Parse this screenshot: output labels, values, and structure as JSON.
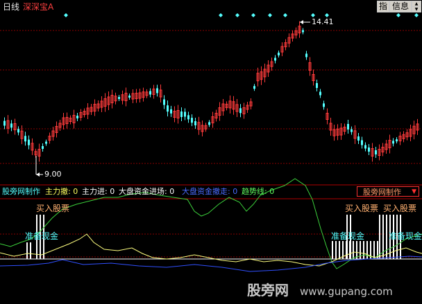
{
  "topbar": {
    "period": "日线",
    "stock_name": "深深宝A",
    "btn_indicator": "指",
    "btn_info": "信息",
    "btn_down_arrow": "▼",
    "btn_up_arrow": "▲"
  },
  "main_chart": {
    "high_label": "14.41",
    "low_label": "9.00"
  },
  "indicator_bar": {
    "name": "股旁网制作",
    "items": [
      {
        "label": "主力撤: 0",
        "color": "#ffff60"
      },
      {
        "label": "主力进: 0",
        "color": "#ffffff"
      },
      {
        "label": "大盘资金进场: 0",
        "color": "#ffffff"
      },
      {
        "label": "大盘资金撤走: 0",
        "color": "#4a6cff"
      },
      {
        "label": "趋势线: 0",
        "color": "#60ff60"
      }
    ],
    "selector_label": "股旁网制作",
    "selector_arrow": "▼"
  },
  "annotations": {
    "buy_label": "买入股票",
    "prepare_label": "准备现金"
  },
  "watermark": {
    "brand": "股旁网",
    "url": "www.gupang.com"
  },
  "colors": {
    "up": "#ff3b3b",
    "down": "#54ffff",
    "grid": "#8a0000",
    "signal": "#54ffff",
    "trend": "#3cd23c",
    "yellow_line": "#ffff80",
    "blue_line": "#3050ff",
    "zero_line": "#ffffff"
  },
  "signal_diamonds": [
    "diamond",
    "diamond",
    "diamond",
    "diamond",
    "diamond",
    "diamond",
    "diamond",
    "diamond",
    "diamond",
    "diamond"
  ]
}
